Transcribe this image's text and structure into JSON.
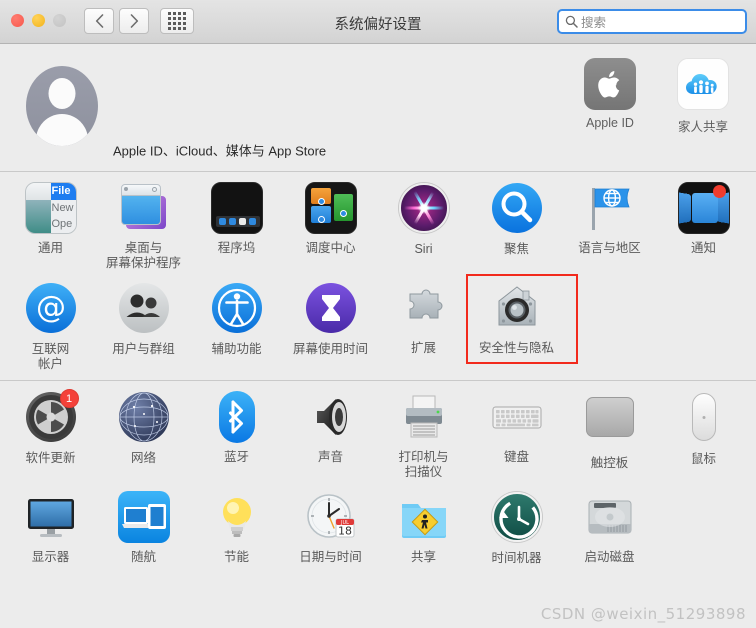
{
  "window": {
    "title": "系统偏好设置",
    "traffic_lights": [
      "close",
      "minimize",
      "zoom"
    ]
  },
  "toolbar": {
    "back_label": "后退",
    "forward_label": "前进",
    "grid_label": "显示全部",
    "search": {
      "placeholder": "搜索",
      "value": "",
      "icon": "search-icon",
      "focused": true,
      "focus_color": "#3b8ce8"
    }
  },
  "account": {
    "description": "Apple ID、iCloud、媒体与 App Store",
    "avatar_icon": "user-avatar-icon",
    "tiles": [
      {
        "label": "Apple ID",
        "icon": "apple-logo-icon"
      },
      {
        "label": "家人共享",
        "icon": "family-sharing-icon"
      }
    ]
  },
  "sections": [
    {
      "name": "personal",
      "rows": [
        [
          {
            "label": "通用",
            "icon": "general-icon"
          },
          {
            "label": "桌面与\n屏幕保护程序",
            "icon": "desktop-screensaver-icon"
          },
          {
            "label": "程序坞",
            "icon": "dock-icon"
          },
          {
            "label": "调度中心",
            "icon": "mission-control-icon"
          },
          {
            "label": "Siri",
            "icon": "siri-icon"
          },
          {
            "label": "聚焦",
            "icon": "spotlight-icon"
          },
          {
            "label": "语言与地区",
            "icon": "language-region-icon"
          },
          {
            "label": "通知",
            "icon": "notifications-icon"
          }
        ],
        [
          {
            "label": "互联网\n帐户",
            "icon": "internet-accounts-icon"
          },
          {
            "label": "用户与群组",
            "icon": "users-groups-icon"
          },
          {
            "label": "辅助功能",
            "icon": "accessibility-icon"
          },
          {
            "label": "屏幕使用时间",
            "icon": "screen-time-icon"
          },
          {
            "label": "扩展",
            "icon": "extensions-icon"
          },
          {
            "label": "安全性与隐私",
            "icon": "security-privacy-icon",
            "highlighted": true
          }
        ]
      ]
    },
    {
      "name": "hardware",
      "rows": [
        [
          {
            "label": "软件更新",
            "icon": "software-update-icon",
            "badge": "1"
          },
          {
            "label": "网络",
            "icon": "network-icon"
          },
          {
            "label": "蓝牙",
            "icon": "bluetooth-icon"
          },
          {
            "label": "声音",
            "icon": "sound-icon"
          },
          {
            "label": "打印机与\n扫描仪",
            "icon": "printers-scanners-icon"
          },
          {
            "label": "键盘",
            "icon": "keyboard-icon"
          },
          {
            "label": "触控板",
            "icon": "trackpad-icon"
          },
          {
            "label": "鼠标",
            "icon": "mouse-icon"
          }
        ],
        [
          {
            "label": "显示器",
            "icon": "displays-icon"
          },
          {
            "label": "随航",
            "icon": "sidecar-icon"
          },
          {
            "label": "节能",
            "icon": "energy-saver-icon"
          },
          {
            "label": "日期与时间",
            "icon": "date-time-icon",
            "date_month": "JUL",
            "date_day": "18"
          },
          {
            "label": "共享",
            "icon": "sharing-icon"
          },
          {
            "label": "时间机器",
            "icon": "time-machine-icon"
          },
          {
            "label": "启动磁盘",
            "icon": "startup-disk-icon"
          }
        ]
      ]
    }
  ],
  "highlight": {
    "color": "#f22a1c",
    "target": "安全性与隐私"
  },
  "watermark": "CSDN @weixin_51293898"
}
